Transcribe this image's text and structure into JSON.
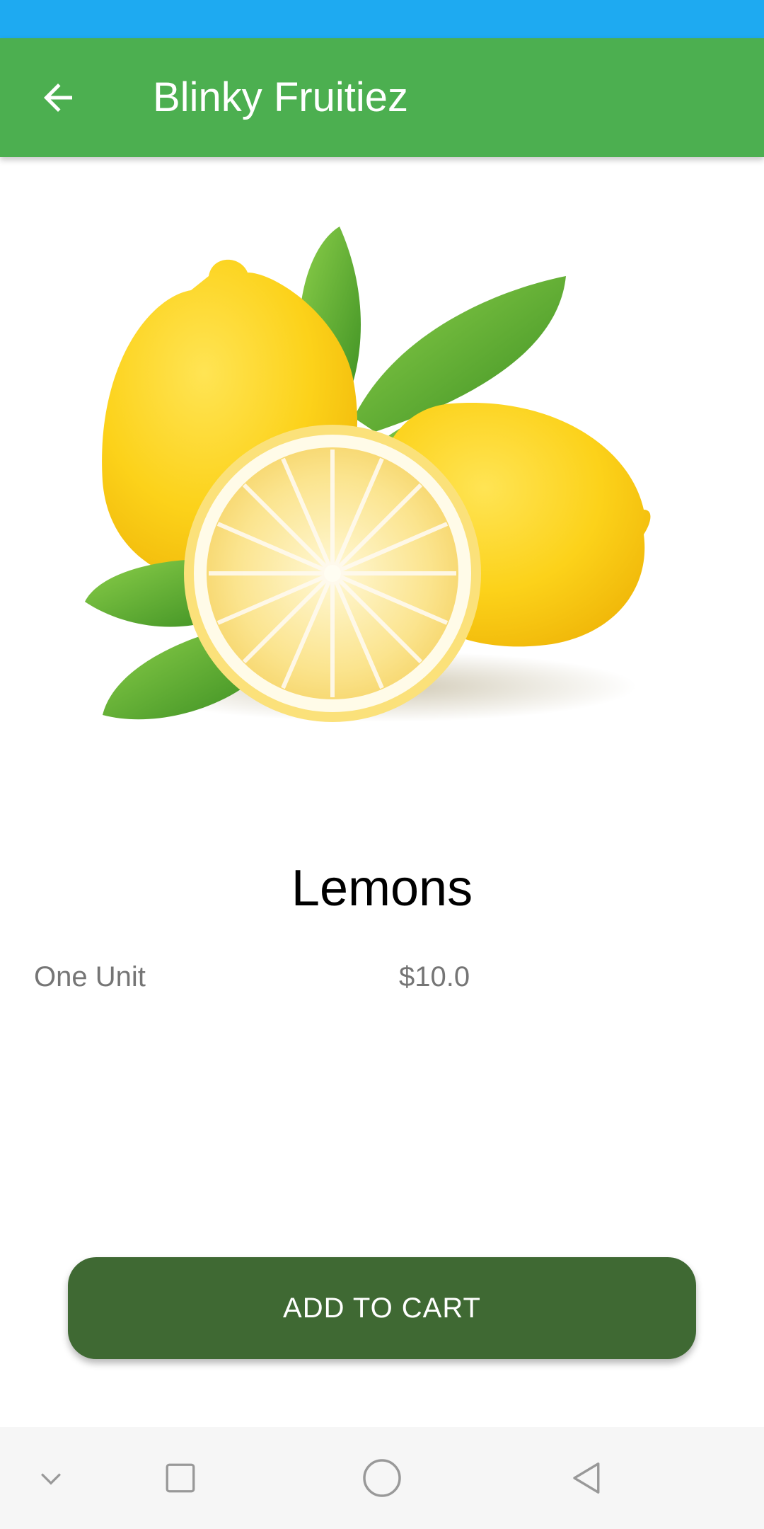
{
  "status_bar": {
    "color": "#1eaaf1"
  },
  "app_bar": {
    "title": "Blinky Fruitiez",
    "back_icon": "arrow-left-icon",
    "color": "#4caf50"
  },
  "product": {
    "image_icon": "lemons-image",
    "name": "Lemons",
    "unit": "One Unit",
    "price": "$10.0"
  },
  "actions": {
    "add_to_cart_label": "ADD TO CART",
    "button_color": "#3f6933"
  },
  "nav_bar": {
    "items": [
      {
        "icon": "chevron-down-icon"
      },
      {
        "icon": "square-recents-icon"
      },
      {
        "icon": "circle-home-icon"
      },
      {
        "icon": "triangle-back-icon"
      }
    ]
  }
}
